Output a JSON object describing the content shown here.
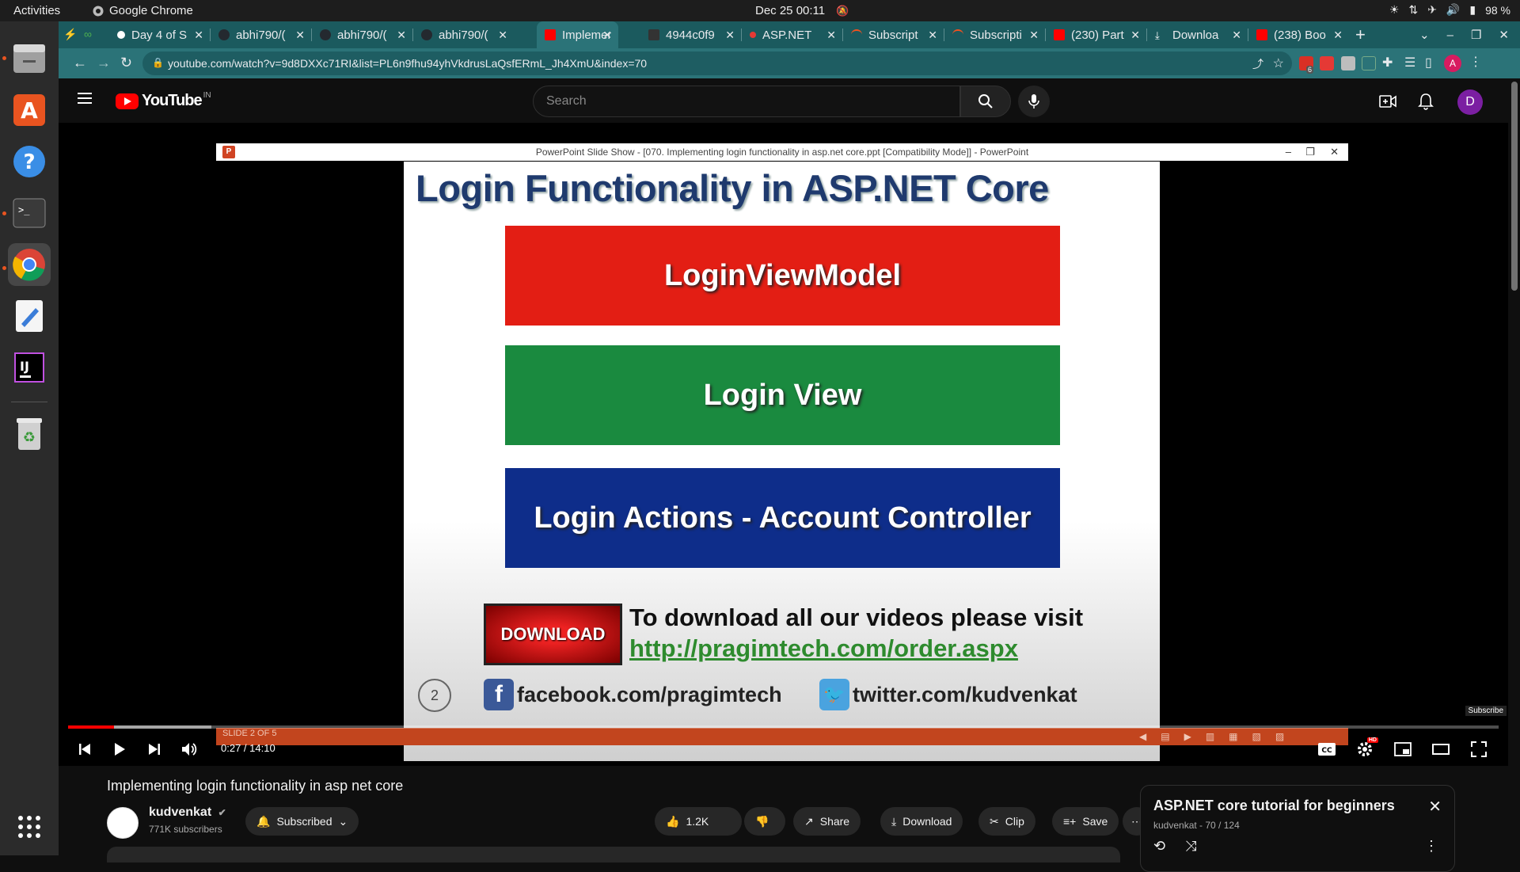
{
  "system": {
    "activities": "Activities",
    "app_name": "Google Chrome",
    "clock": "Dec 25  00:11",
    "battery": "98 %"
  },
  "browser": {
    "tabs": [
      {
        "label": "Day 4 of S",
        "color": "#ffffff"
      },
      {
        "label": "abhi790/(",
        "color": "#24292f"
      },
      {
        "label": "abhi790/(",
        "color": "#24292f"
      },
      {
        "label": "abhi790/(",
        "color": "#24292f"
      },
      {
        "label": "Implemen",
        "color": "#ff0000"
      },
      {
        "label": "4944c0f9",
        "color": "#333333"
      },
      {
        "label": "ASP.NET",
        "color": "#e53935"
      },
      {
        "label": "Subscript",
        "color": "#f4511e"
      },
      {
        "label": "Subscripti",
        "color": "#f4511e"
      },
      {
        "label": "(230) Part",
        "color": "#ff0000"
      },
      {
        "label": "Downloa",
        "color": "#ffffff"
      },
      {
        "label": "(238) Boo",
        "color": "#ff0000"
      }
    ],
    "url": "youtube.com/watch?v=9d8DXXc71RI&list=PL6n9fhu94yhVkdrusLaQsfERmL_Jh4XmU&index=70",
    "extension_badge": "6",
    "profile_initial": "A"
  },
  "youtube": {
    "logo_text": "YouTube",
    "country_code": "IN",
    "search_placeholder": "Search",
    "avatar_initial": "D"
  },
  "player": {
    "powerpoint_title": "PowerPoint Slide Show - [070. Implementing login functionality in asp.net core.ppt [Compatibility Mode]] - PowerPoint",
    "slide": {
      "title": "Login Functionality in ASP.NET Core",
      "boxes": [
        {
          "label": "LoginViewModel",
          "color": "#e31e14"
        },
        {
          "label": "Login View",
          "color": "#1a8a3f"
        },
        {
          "label": "Login Actions - Account Controller",
          "color": "#0e2d8a"
        }
      ],
      "download_button": "DOWNLOAD",
      "download_text": "To download all our videos please visit",
      "download_link": "http://pragimtech.com/order.aspx",
      "slide_number": "2",
      "facebook": "facebook.com/pragimtech",
      "twitter": "twitter.com/kudvenkat"
    },
    "subscribe_watermark": "Subscribe",
    "slide_status": "SLIDE 2 OF 5",
    "time": "0:27 / 14:10",
    "played_fraction": 0.032,
    "loaded_fraction": 0.1,
    "quality_badge": "HD"
  },
  "video": {
    "title": "Implementing login functionality in asp net core",
    "channel": "kudvenkat",
    "subscribers": "771K subscribers",
    "subscribed_label": "Subscribed",
    "likes": "1.2K",
    "share": "Share",
    "download": "Download",
    "clip": "Clip",
    "save": "Save"
  },
  "playlist": {
    "title": "ASP.NET core tutorial for beginners",
    "subtitle": "kudvenkat - 70 / 124"
  }
}
